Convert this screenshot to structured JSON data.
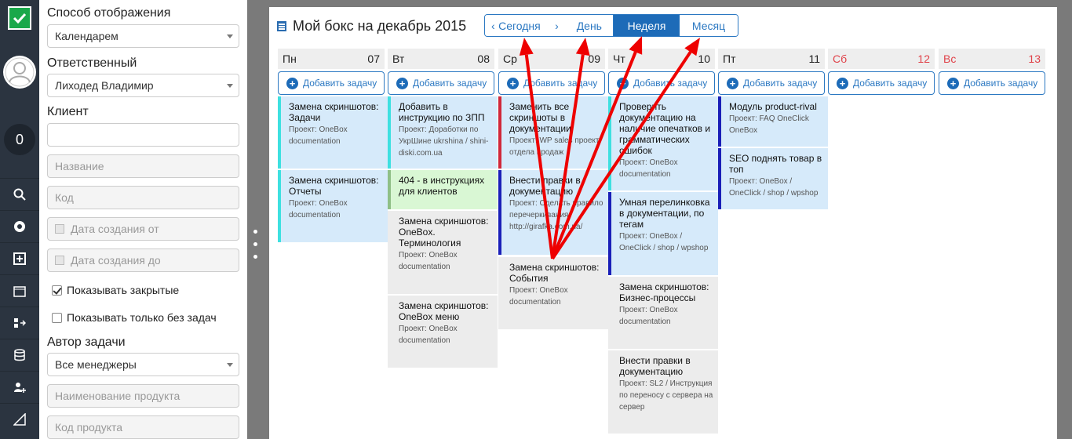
{
  "filters": {
    "display_mode_label": "Способ отображения",
    "display_mode_value": "Календарем",
    "responsible_label": "Ответственный",
    "responsible_value": "Лиходед Владимир",
    "client_label": "Клиент",
    "client_value": "",
    "name_placeholder": "Название",
    "code_placeholder": "Код",
    "created_from_placeholder": "Дата создания от",
    "created_to_placeholder": "Дата создания до",
    "show_closed_label": "Показывать закрытые",
    "show_closed_checked": true,
    "show_without_tasks_label": "Показывать только без задач",
    "show_without_tasks_checked": false,
    "author_label": "Автор задачи",
    "author_value": "Все менеджеры",
    "product_name_placeholder": "Наименование продукта",
    "product_code_placeholder": "Код продукта"
  },
  "rail": {
    "notification_count": "0",
    "icons": [
      "search-icon",
      "support-icon",
      "add-icon",
      "calendar-icon",
      "transfer-icon",
      "database-icon",
      "add-user-icon",
      "ruler-icon"
    ]
  },
  "calendar": {
    "title": "Мой бокс на декабрь 2015",
    "nav": {
      "prev": "‹",
      "today": "Сегодня",
      "next": "›",
      "day": "День",
      "week": "Неделя",
      "month": "Месяц",
      "active": "Неделя"
    },
    "add_task_label": "Добавить задачу",
    "days": [
      {
        "name": "Пн",
        "date": "07",
        "weekend": false
      },
      {
        "name": "Вт",
        "date": "08",
        "weekend": false
      },
      {
        "name": "Ср",
        "date": "09",
        "weekend": false
      },
      {
        "name": "Чт",
        "date": "10",
        "weekend": false
      },
      {
        "name": "Пт",
        "date": "11",
        "weekend": false
      },
      {
        "name": "Сб",
        "date": "12",
        "weekend": true
      },
      {
        "name": "Вс",
        "date": "13",
        "weekend": true
      }
    ],
    "tasks": {
      "mon": [
        {
          "title": "Замена скриншотов: Задачи",
          "project": "Проект: OneBox documentation"
        },
        {
          "title": "Замена скриншотов: Отчеты",
          "project": "Проект: OneBox documentation"
        }
      ],
      "tue": [
        {
          "title": "Добавить в инструкцию по ЗПП",
          "project": "Проект: Доработки по УкрШине ukrshina / shini-diski.com.ua"
        },
        {
          "title": "404 - в инструкциях для клиентов",
          "project": ""
        },
        {
          "title": "Замена скриншотов: OneBox. Терминология",
          "project": "Проект: OneBox documentation"
        },
        {
          "title": "Замена скриншотов: OneBox меню",
          "project": "Проект: OneBox documentation"
        }
      ],
      "wed": [
        {
          "title": "Заменить все скриншоты в документации",
          "project": "Проект: WP sales проект отдела продаж"
        },
        {
          "title": "Внести правки в документацию",
          "project": "Проект: Сделать правило перечеркивания http://girafka.com.ua/"
        },
        {
          "title": "Замена скриншотов: События",
          "project": "Проект: OneBox documentation"
        }
      ],
      "thu": [
        {
          "title": "Проверить документацию на наличие опечатков и грамматических ошибок",
          "project": "Проект: OneBox documentation"
        },
        {
          "title": "Умная перелинковка в документации, по тегам",
          "project": "Проект: OneBox / OneClick / shop / wpshop"
        },
        {
          "title": "Замена скриншотов: Бизнес-процессы",
          "project": "Проект: OneBox documentation"
        },
        {
          "title": "Внести правки в документацию",
          "project": "Проект: SL2 / Инструкция по переносу с сервера на сервер"
        }
      ],
      "fri": [
        {
          "title": "Модуль product-rival",
          "project": "Проект: FAQ OneClick OneBox"
        },
        {
          "title": "SEO поднять товар в топ",
          "project": "Проект: OneBox / OneClick / shop / wpshop"
        }
      ]
    }
  },
  "colors": {
    "accent": "#1d6bb8",
    "arrow": "#ee0000",
    "weekend": "#e0434a",
    "task_blue_bg": "#d6eafa",
    "task_cyan": "#3ee0e0",
    "task_red": "#d0283a",
    "task_navy": "#1a1fb8",
    "task_green_bg": "#d9f7d4"
  }
}
